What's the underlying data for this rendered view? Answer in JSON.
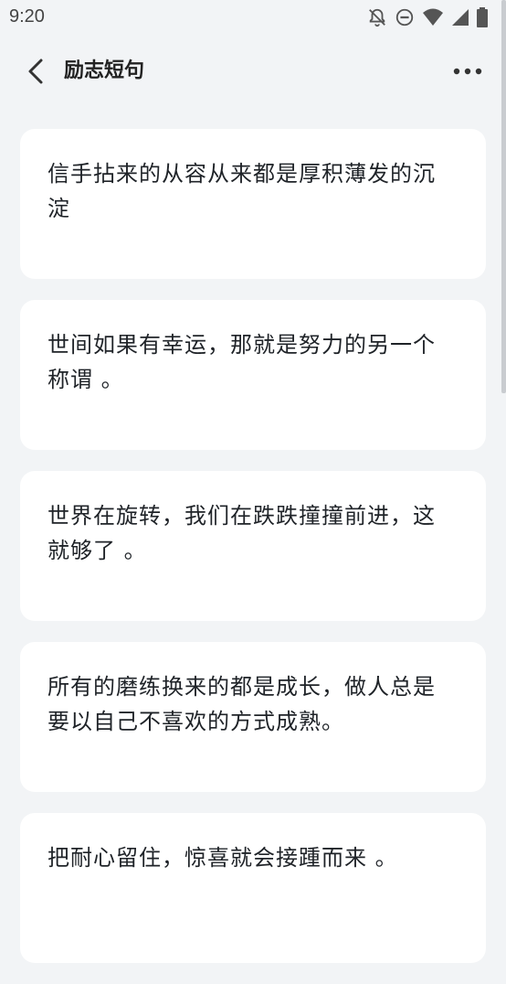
{
  "status_bar": {
    "time": "9:20",
    "icons": [
      "notifications-off-icon",
      "do-not-disturb-icon",
      "wifi-icon",
      "cellular-signal-icon",
      "battery-icon"
    ]
  },
  "app_bar": {
    "title": "励志短句",
    "back_icon": "chevron-left-icon",
    "more_icon": "more-horizontal-icon"
  },
  "quotes": [
    {
      "text": "信手拈来的从容从来都是厚积薄发的沉淀"
    },
    {
      "text": "世间如果有幸运，那就是努力的另一个称谓 。"
    },
    {
      "text": "世界在旋转，我们在跌跌撞撞前进，这就够了 。"
    },
    {
      "text": "所有的磨练换来的都是成长，做人总是要以自己不喜欢的方式成熟。"
    },
    {
      "text": "把耐心留住，惊喜就会接踵而来 。"
    }
  ],
  "colors": {
    "background": "#f2f4f6",
    "card": "#ffffff",
    "text": "#1f2328"
  }
}
